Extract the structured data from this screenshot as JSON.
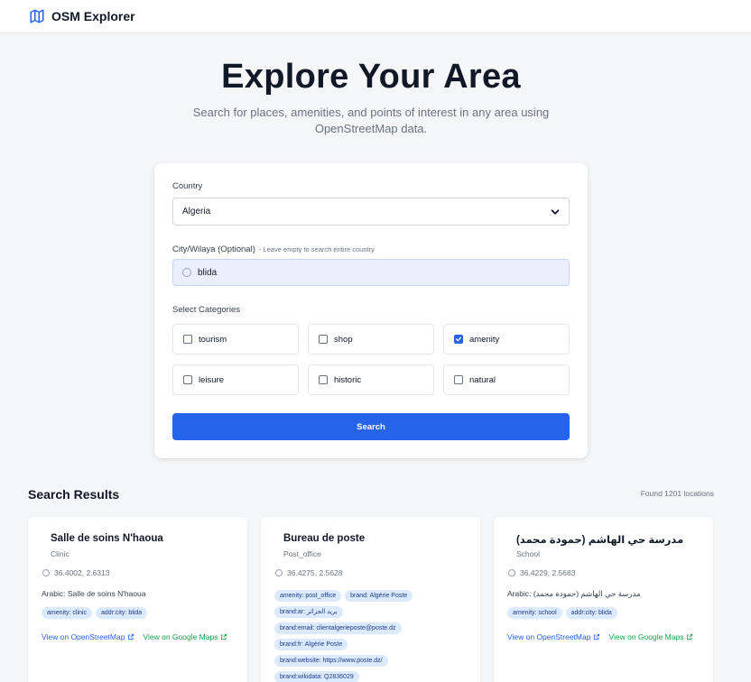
{
  "app": {
    "title": "OSM Explorer"
  },
  "hero": {
    "title": "Explore Your Area",
    "subtitle": "Search for places, amenities, and points of interest in any area using OpenStreetMap data."
  },
  "search_form": {
    "country_label": "Country",
    "country_value": "Algeria",
    "city_label": "City/Wilaya (Optional)",
    "city_hint": "- Leave empty to search entire country",
    "city_value": "blida",
    "categories_label": "Select Categories",
    "categories": [
      {
        "label": "tourism",
        "checked": false
      },
      {
        "label": "shop",
        "checked": false
      },
      {
        "label": "amenity",
        "checked": true
      },
      {
        "label": "leisure",
        "checked": false
      },
      {
        "label": "historic",
        "checked": false
      },
      {
        "label": "natural",
        "checked": false
      }
    ],
    "search_button": "Search"
  },
  "results": {
    "title": "Search Results",
    "count_text": "Found 1201 locations",
    "osm_link_label": "View on OpenStreetMap",
    "gmaps_link_label": "View on Google Maps",
    "items": [
      {
        "name": "Salle de soins N'haoua",
        "type": "Clinic",
        "coords": "36.4002, 2.6313",
        "arabic": "Arabic: Salle de soins N'haoua",
        "tags": [
          "amenity: clinic",
          "addr:city: blida"
        ]
      },
      {
        "name": "Bureau de poste",
        "type": "Post_office",
        "coords": "36.4275, 2.5628",
        "arabic": "",
        "tags": [
          "amenity: post_office",
          "brand: Algérie Poste",
          "brand:ar: بريد الجزائر",
          "brand:email: clientalgerieposte@poste.dz",
          "brand:fr: Algérie Poste",
          "brand:website: https://www.poste.dz/",
          "brand:wikidata: Q2836029"
        ]
      },
      {
        "name": "مدرسة حي الهاشم (حمودة محمد)",
        "type": "School",
        "coords": "36.4229, 2.5683",
        "arabic": "Arabic: مدرسة حي الهاشم (حمودة محمد)",
        "tags": [
          "amenity: school",
          "addr:city: blida"
        ]
      }
    ]
  },
  "colors": {
    "accent": "#2563eb",
    "tag_bg": "#dbeafe",
    "gmaps_link": "#16a34a"
  },
  "icons": {
    "brand": "map-icon",
    "select": "chevron-down-icon",
    "city": "search-icon",
    "coords": "location-pin-icon",
    "link": "external-link-icon"
  }
}
